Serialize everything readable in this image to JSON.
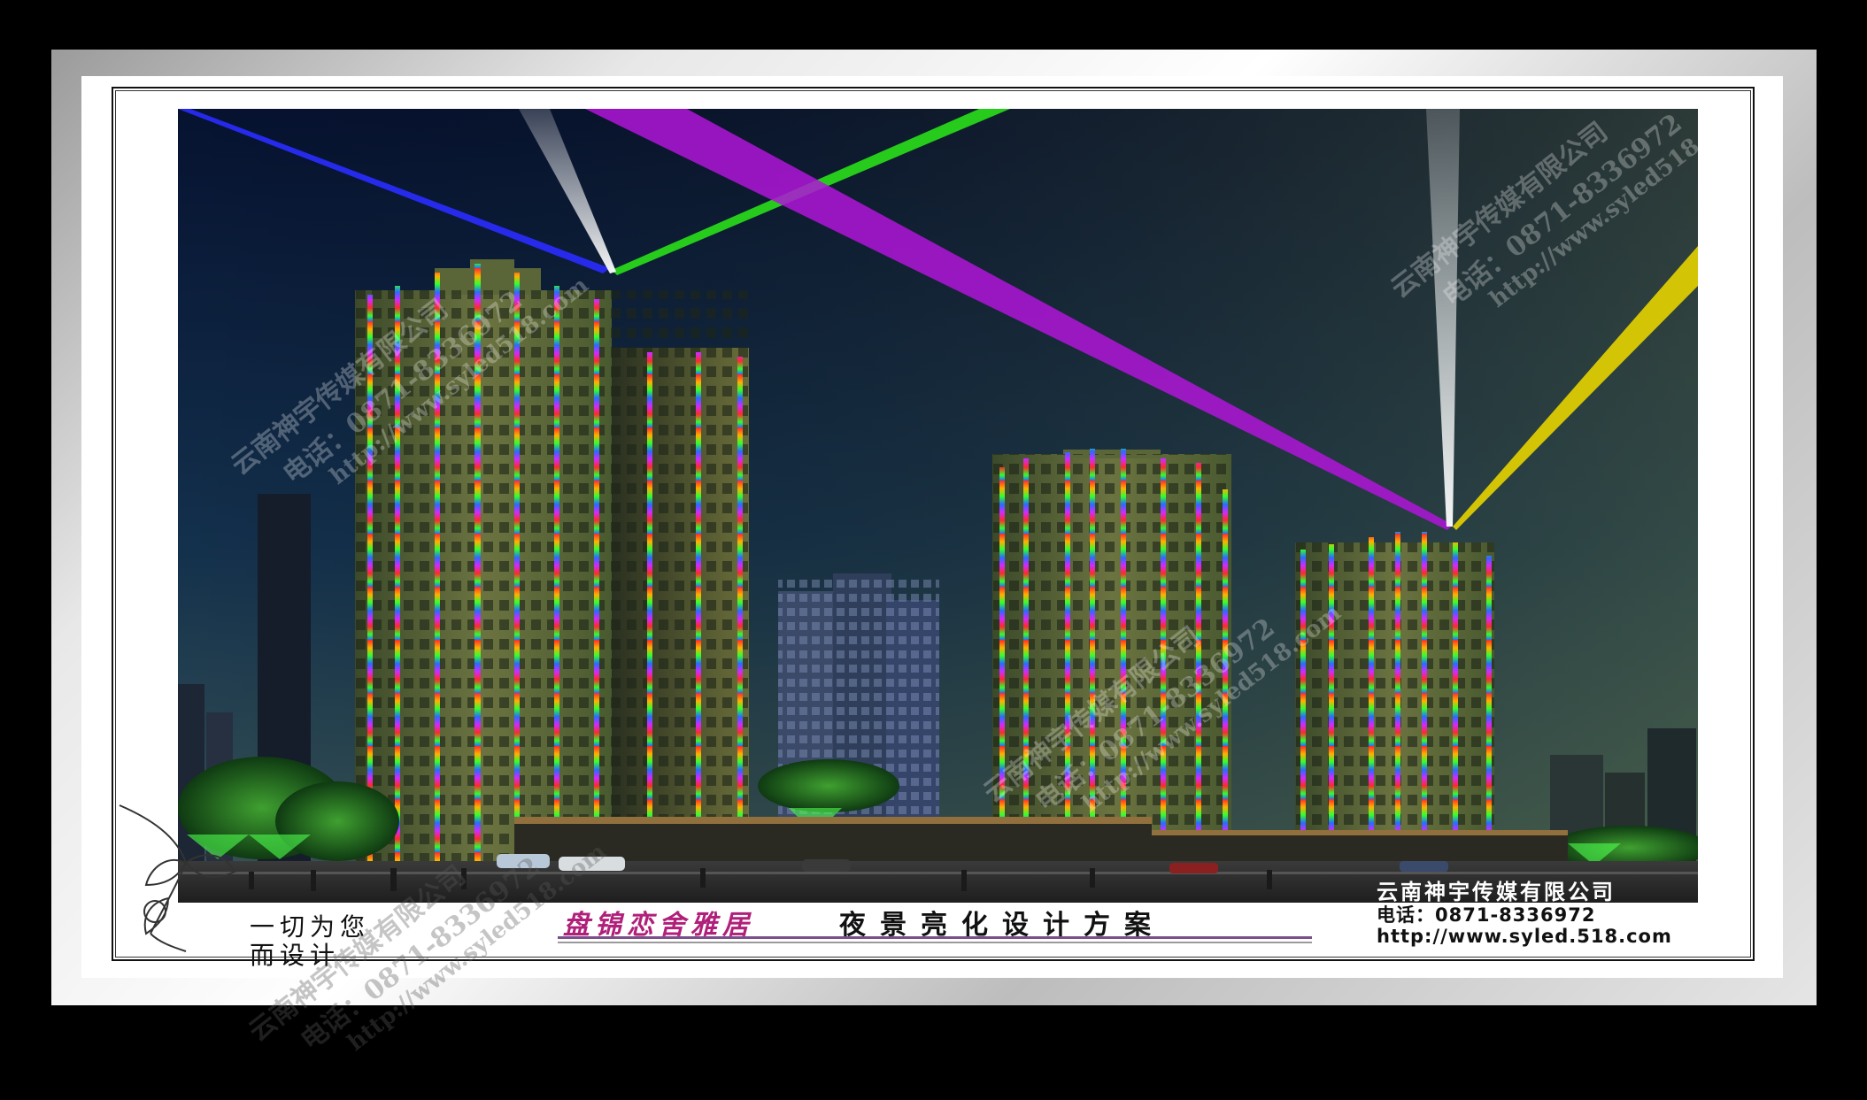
{
  "watermark": {
    "company": "云南神宇传媒有限公司",
    "phone": "电话：0871-8336972",
    "website": "http://www.syled518.com"
  },
  "footer": {
    "company": "云南神宇传媒有限公司",
    "phone": "电话：0871-8336972",
    "website": "http://www.syled.518.com"
  },
  "slogan": {
    "line1": "一切为您",
    "line2": "而设计"
  },
  "title": {
    "project": "盘锦恋舍雅居",
    "plan": "夜景亮化设计方案"
  },
  "colors": {
    "sky_top": "#06122a",
    "sky_bottom": "#2c4a4a",
    "beam_blue": "#2a2cff",
    "beam_green": "#2adf1a",
    "beam_purple": "#b015d8",
    "beam_yellow": "#e6d400",
    "beam_white": "#f2f2f2",
    "footer_text": "#111111",
    "project_title": "#b0207a"
  },
  "icons": [
    "flower-sketch-icon"
  ]
}
